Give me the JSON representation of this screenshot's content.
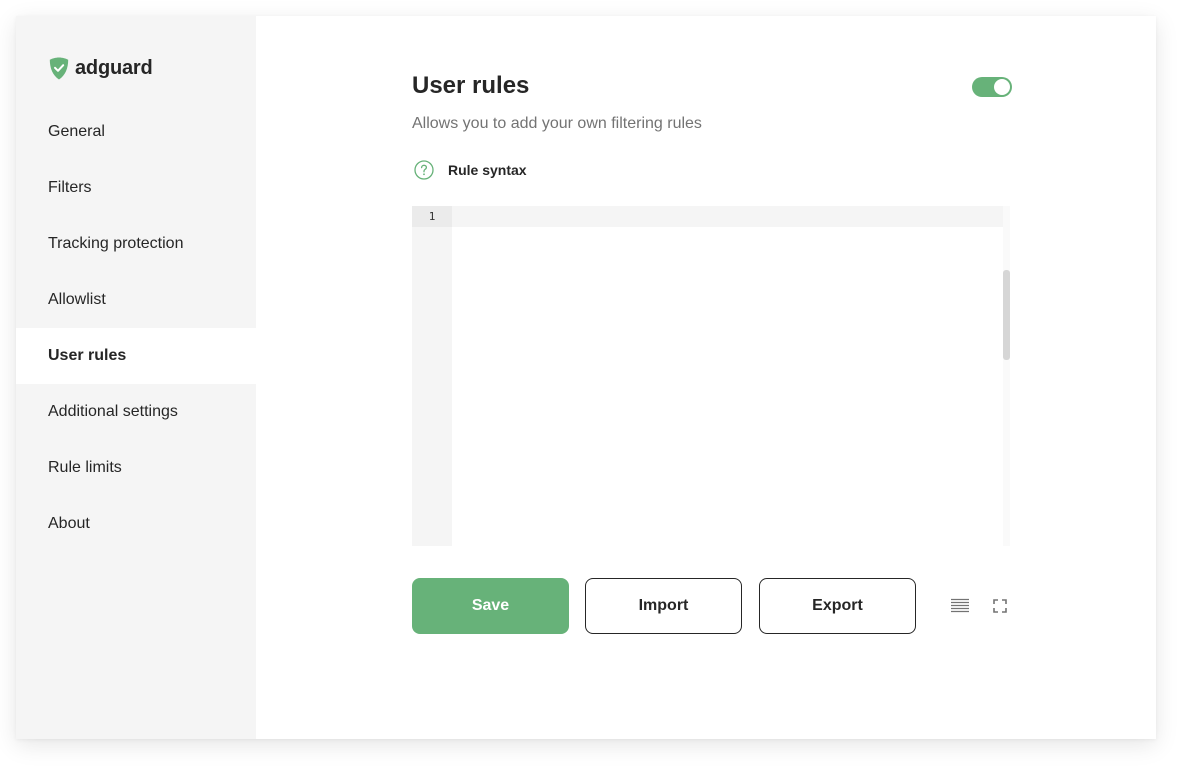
{
  "brand": {
    "name": "adguard",
    "icon": "shield-check-icon",
    "color": "#67b279"
  },
  "sidebar": {
    "items": [
      {
        "label": "General",
        "active": false
      },
      {
        "label": "Filters",
        "active": false
      },
      {
        "label": "Tracking protection",
        "active": false
      },
      {
        "label": "Allowlist",
        "active": false
      },
      {
        "label": "User rules",
        "active": true
      },
      {
        "label": "Additional settings",
        "active": false
      },
      {
        "label": "Rule limits",
        "active": false
      },
      {
        "label": "About",
        "active": false
      }
    ]
  },
  "main": {
    "title": "User rules",
    "enabled": true,
    "subtitle": "Allows you to add your own filtering rules",
    "syntax_link": {
      "label": "Rule syntax",
      "icon": "question-circle-icon"
    },
    "editor": {
      "line_numbers": [
        "1"
      ],
      "content": ""
    },
    "buttons": {
      "save": "Save",
      "import": "Import",
      "export": "Export"
    },
    "tools": {
      "wrap_icon": "text-wrap-icon",
      "fullscreen_icon": "fullscreen-icon"
    }
  },
  "colors": {
    "accent": "#67b279",
    "sidebar_bg": "#f5f5f5",
    "text": "#262626",
    "muted_text": "#737373"
  }
}
